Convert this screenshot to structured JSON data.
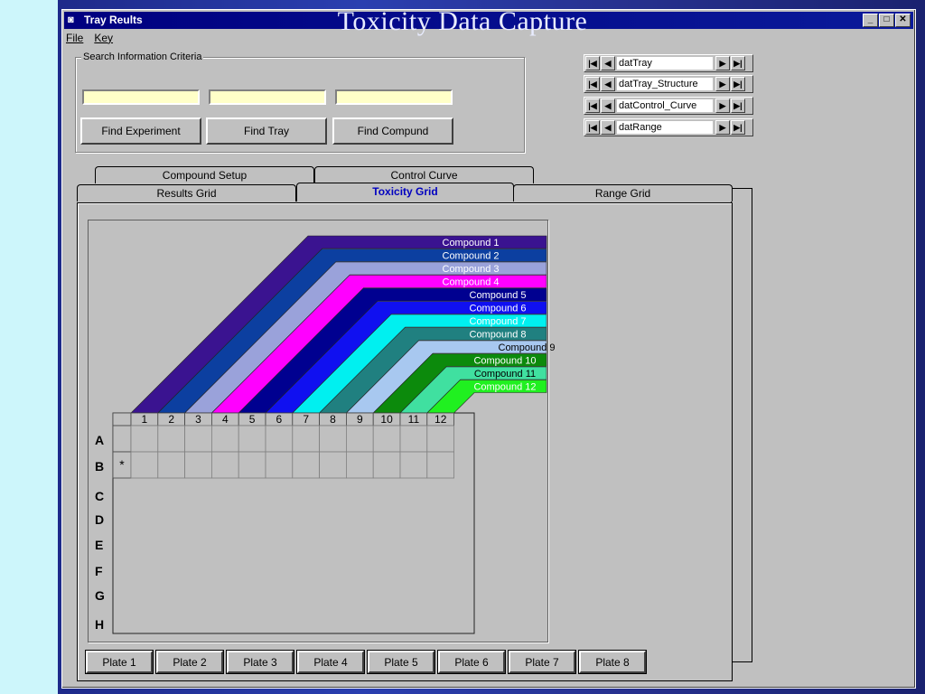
{
  "slide": {
    "title": "Toxicity Data Capture"
  },
  "window": {
    "title": "Tray Reults",
    "icon": "app-icon",
    "controls": [
      "_",
      "□",
      "✕"
    ]
  },
  "menu": [
    "File",
    "Key"
  ],
  "search": {
    "frame_label": "Search Information Criteria",
    "inputs": [
      "",
      "",
      ""
    ],
    "buttons": [
      "Find Experiment",
      "Find Tray",
      "Find Compund"
    ]
  },
  "data_controls": [
    "datTray",
    "datTray_Structure",
    "datControl_Curve",
    "datRange"
  ],
  "tabs": {
    "back_row": [
      "Compound Setup",
      "Control Curve"
    ],
    "front_row": [
      "Results Grid",
      "Toxicity Grid",
      "Range Grid"
    ],
    "active": "Toxicity Grid"
  },
  "compounds": [
    {
      "label": "Compound 1",
      "color": "#3a1390"
    },
    {
      "label": "Compound 2",
      "color": "#0c3fa0"
    },
    {
      "label": "Compound 3",
      "color": "#9aa2da"
    },
    {
      "label": "Compound 4",
      "color": "#ff00ff"
    },
    {
      "label": "Compound 5",
      "color": "#000090"
    },
    {
      "label": "Compound 6",
      "color": "#1010f0"
    },
    {
      "label": "Compound 7",
      "color": "#00f0f0"
    },
    {
      "label": "Compound 8",
      "color": "#208080"
    },
    {
      "label": "Compound 9",
      "color": "#a8c8f0"
    },
    {
      "label": "Compound 10",
      "color": "#0c8a0c"
    },
    {
      "label": "Compound 11",
      "color": "#40e0a0"
    },
    {
      "label": "Compound 12",
      "color": "#20f020"
    }
  ],
  "grid": {
    "columns": [
      "1",
      "2",
      "3",
      "4",
      "5",
      "6",
      "7",
      "8",
      "9",
      "10",
      "11",
      "12"
    ],
    "rows": [
      "A",
      "B",
      "C",
      "D",
      "E",
      "F",
      "G",
      "H"
    ],
    "new_row_marker": "*"
  },
  "plates": [
    "Plate 1",
    "Plate 2",
    "Plate 3",
    "Plate 4",
    "Plate 5",
    "Plate 6",
    "Plate 7",
    "Plate 8"
  ]
}
